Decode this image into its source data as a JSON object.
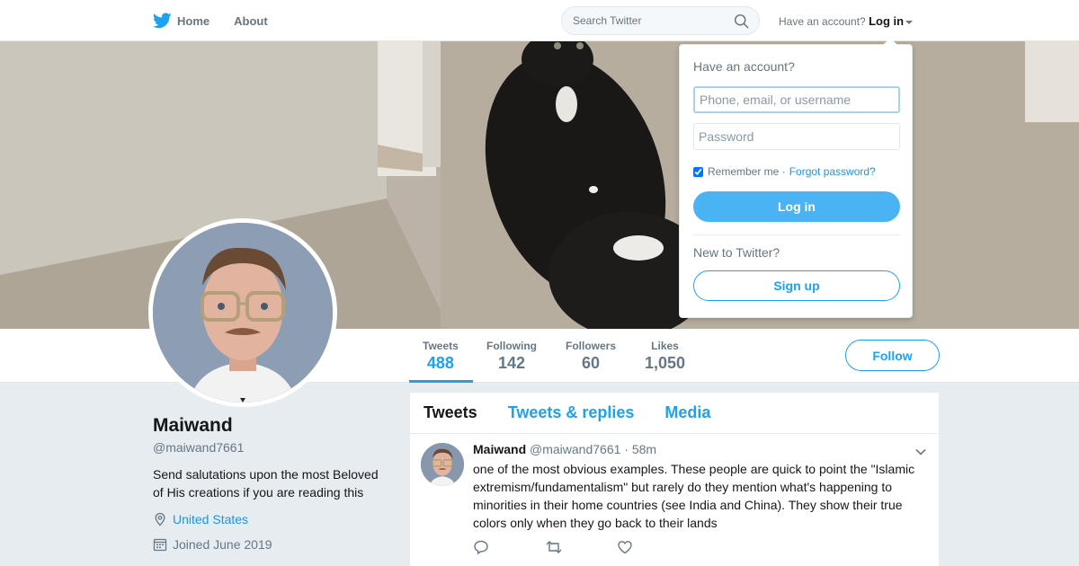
{
  "nav": {
    "home_label": "Home",
    "about_label": "About",
    "search_placeholder": "Search Twitter",
    "have_account": "Have an account?",
    "login_label": "Log in"
  },
  "profile": {
    "name": "Maiwand",
    "handle": "@maiwand7661",
    "bio": "Send salutations upon the most Beloved of His creations if you are reading this",
    "location": "United States",
    "joined": "Joined June 2019",
    "follow_label": "Follow"
  },
  "stats": [
    {
      "label": "Tweets",
      "value": "488",
      "active": true
    },
    {
      "label": "Following",
      "value": "142",
      "active": false
    },
    {
      "label": "Followers",
      "value": "60",
      "active": false
    },
    {
      "label": "Likes",
      "value": "1,050",
      "active": false
    }
  ],
  "timeline": {
    "tabs": [
      "Tweets",
      "Tweets & replies",
      "Media"
    ],
    "tweet": {
      "name": "Maiwand",
      "handle": "@maiwand7661",
      "time": "58m",
      "separator": "·",
      "text": "one of the most obvious examples. These people are quick to point the \"Islamic extremism/fundamentalism\" but rarely do they mention what's happening to minorities in their home countries (see India and China). They show their true colors only when they go back to their lands"
    }
  },
  "login_dropdown": {
    "title": "Have an account?",
    "username_placeholder": "Phone, email, or username",
    "password_placeholder": "Password",
    "remember_label": "Remember me ·",
    "forgot_label": "Forgot password?",
    "login_button": "Log in",
    "new_label": "New to Twitter?",
    "signup_button": "Sign up",
    "remember_checked": true
  },
  "colors": {
    "accent": "#1da1f2",
    "login_button": "#4ab3f4",
    "background": "#e6ecf0"
  },
  "icons": [
    "twitter-bird-icon",
    "home-icon",
    "search-icon",
    "location-pin-icon",
    "calendar-icon",
    "reply-icon",
    "retweet-icon",
    "like-icon",
    "chevron-down-icon"
  ]
}
